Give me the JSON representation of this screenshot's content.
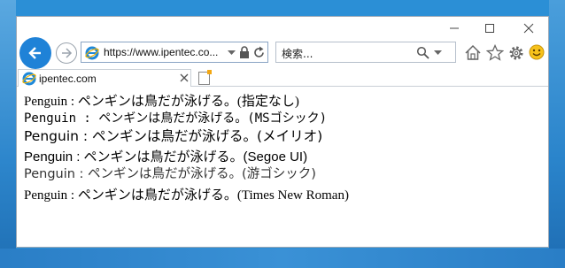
{
  "browser": {
    "address_url": "https://www.ipentec.co...",
    "search_placeholder": "検索...",
    "tab_label": "ipentec.com"
  },
  "content": {
    "lines": [
      "Penguin : ペンギンは鳥だが泳げる。(指定なし)",
      "Penguin : ペンギンは鳥だが泳げる。(MSゴシック)",
      "Penguin : ペンギンは鳥だが泳げる。(メイリオ)",
      "Penguin : ペンギンは鳥だが泳げる。(Segoe UI)",
      "Penguin : ペンギンは鳥だが泳げる。(游ゴシック)",
      "Penguin : ペンギンは鳥だが泳げる。(Times New Roman)"
    ]
  },
  "colors": {
    "accent": "#1f82d7",
    "desktop": "#2b8fd6",
    "smiley": "#f7c21b"
  },
  "icons": {
    "back": "back-arrow-icon",
    "forward": "forward-arrow-icon",
    "home": "home-icon",
    "favorites": "star-icon",
    "settings": "gear-icon",
    "feedback": "smiley-icon"
  }
}
